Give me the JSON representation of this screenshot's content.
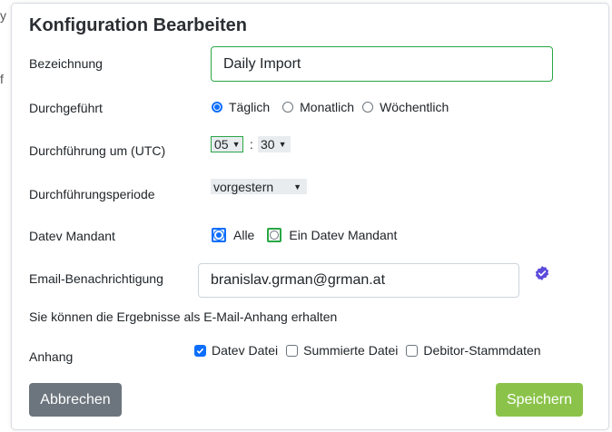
{
  "dialog": {
    "title": "Konfiguration Bearbeiten"
  },
  "form": {
    "name_label": "Bezeichnung",
    "name_value": "Daily Import",
    "executed_label": "Durchgeführt",
    "executed_options": [
      "Täglich",
      "Monatlich",
      "Wöchentlich"
    ],
    "executed_selected": "Täglich",
    "time_label": "Durchführung um (UTC)",
    "hour_value": "05",
    "time_separator": ":",
    "minute_value": "30",
    "period_label": "Durchführungsperiode",
    "period_value": "vorgestern",
    "mandant_label": "Datev Mandant",
    "mandant_options": [
      "Alle",
      "Ein Datev Mandant"
    ],
    "mandant_selected": "Alle",
    "email_label": "Email-Benachrichtigung",
    "email_value": "branislav.grman@grman.at",
    "email_hint": "Sie können die Ergebnisse als E-Mail-Anhang erhalten",
    "attachment_label": "Anhang",
    "attachment_options": [
      {
        "label": "Datev Datei",
        "checked": true
      },
      {
        "label": "Summierte Datei",
        "checked": false
      },
      {
        "label": "Debitor-Stammdaten",
        "checked": false
      }
    ]
  },
  "buttons": {
    "cancel_label": "Abbrechen",
    "save_label": "Speichern"
  },
  "backdrop": {
    "edge_char_1": "y",
    "edge_char_2": "f"
  },
  "colors": {
    "primary": "#0d6efd",
    "valid_green": "#28a745",
    "cancel_gray": "#6c757d",
    "save_green": "#8bc34a",
    "verified_purple": "#5b4bdb"
  }
}
